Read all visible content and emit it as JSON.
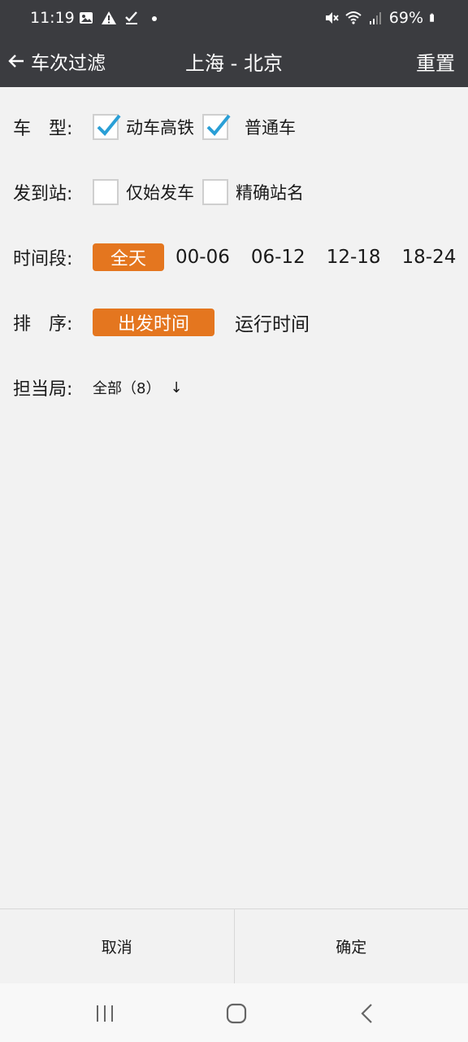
{
  "status": {
    "time": "11:19",
    "battery": "69%",
    "left_icons": [
      "image-icon",
      "warning-icon",
      "check-icon",
      "dot-icon"
    ],
    "right_icons": [
      "mute-icon",
      "wifi-icon",
      "signal-icon",
      "battery-icon"
    ]
  },
  "header": {
    "back_label": "车次过滤",
    "title": "上海 - 北京",
    "reset_label": "重置"
  },
  "filters": {
    "train_type": {
      "label": "车　型:",
      "options": [
        {
          "label": "动车高铁",
          "checked": true
        },
        {
          "label": "普通车",
          "checked": true
        }
      ]
    },
    "station": {
      "label": "发到站:",
      "options": [
        {
          "label": "仅始发车",
          "checked": false
        },
        {
          "label": "精确站名",
          "checked": false
        }
      ]
    },
    "time_period": {
      "label": "时间段:",
      "options": [
        "全天",
        "00-06",
        "06-12",
        "12-18",
        "18-24"
      ],
      "selected": "全天"
    },
    "sort": {
      "label": "排　序:",
      "options": [
        "出发时间",
        "运行时间"
      ],
      "selected": "出发时间"
    },
    "bureau": {
      "label": "担当局:",
      "value": "全部（8）",
      "arrow": "↓"
    }
  },
  "footer": {
    "cancel_label": "取消",
    "confirm_label": "确定"
  },
  "colors": {
    "bar_bg": "#3b3c40",
    "accent": "#e4761f",
    "check": "#2a9fd6",
    "page_bg": "#f2f2f2"
  }
}
